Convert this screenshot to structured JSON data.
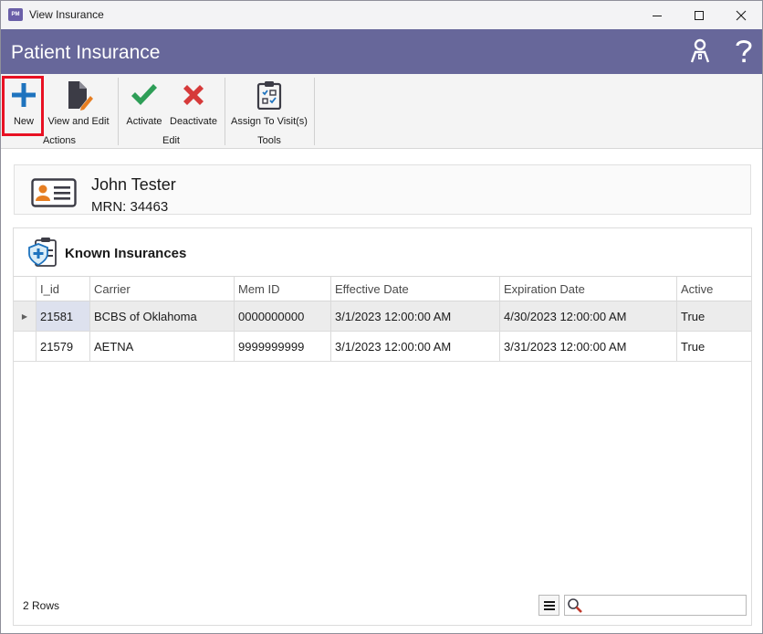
{
  "window": {
    "title": "View Insurance",
    "app_icon_text": "PM"
  },
  "header": {
    "title": "Patient Insurance",
    "icons": [
      "user-keys-icon",
      "help-icon"
    ]
  },
  "ribbon": {
    "groups": [
      {
        "label": "Actions",
        "buttons": [
          {
            "label": "New",
            "icon": "plus-icon"
          },
          {
            "label": "View and Edit",
            "icon": "document-edit-icon"
          }
        ]
      },
      {
        "label": "Edit",
        "buttons": [
          {
            "label": "Activate",
            "icon": "checkmark-icon"
          },
          {
            "label": "Deactivate",
            "icon": "x-icon"
          }
        ]
      },
      {
        "label": "Tools",
        "buttons": [
          {
            "label": "Assign To Visit(s)",
            "icon": "clipboard-checklist-icon"
          }
        ]
      }
    ]
  },
  "patient": {
    "name": "John Tester",
    "mrn": "MRN: 34463"
  },
  "insurances": {
    "title": "Known Insurances",
    "columns": [
      "I_id",
      "Carrier",
      "Mem ID",
      "Effective Date",
      "Expiration Date",
      "Active"
    ],
    "rows": [
      [
        "21581",
        "BCBS of Oklahoma",
        "0000000000",
        "3/1/2023 12:00:00 AM",
        "4/30/2023 12:00:00 AM",
        "True"
      ],
      [
        "21579",
        "AETNA",
        "9999999999",
        "3/1/2023 12:00:00 AM",
        "3/31/2023 12:00:00 AM",
        "True"
      ]
    ],
    "row_count": "2 Rows",
    "search": {
      "value": "",
      "placeholder": ""
    }
  },
  "colors": {
    "header_bg": "#67679a",
    "highlight": "#e81123",
    "plus_blue": "#1e73be",
    "check_green": "#2e9e57",
    "x_red": "#d63a3a"
  }
}
